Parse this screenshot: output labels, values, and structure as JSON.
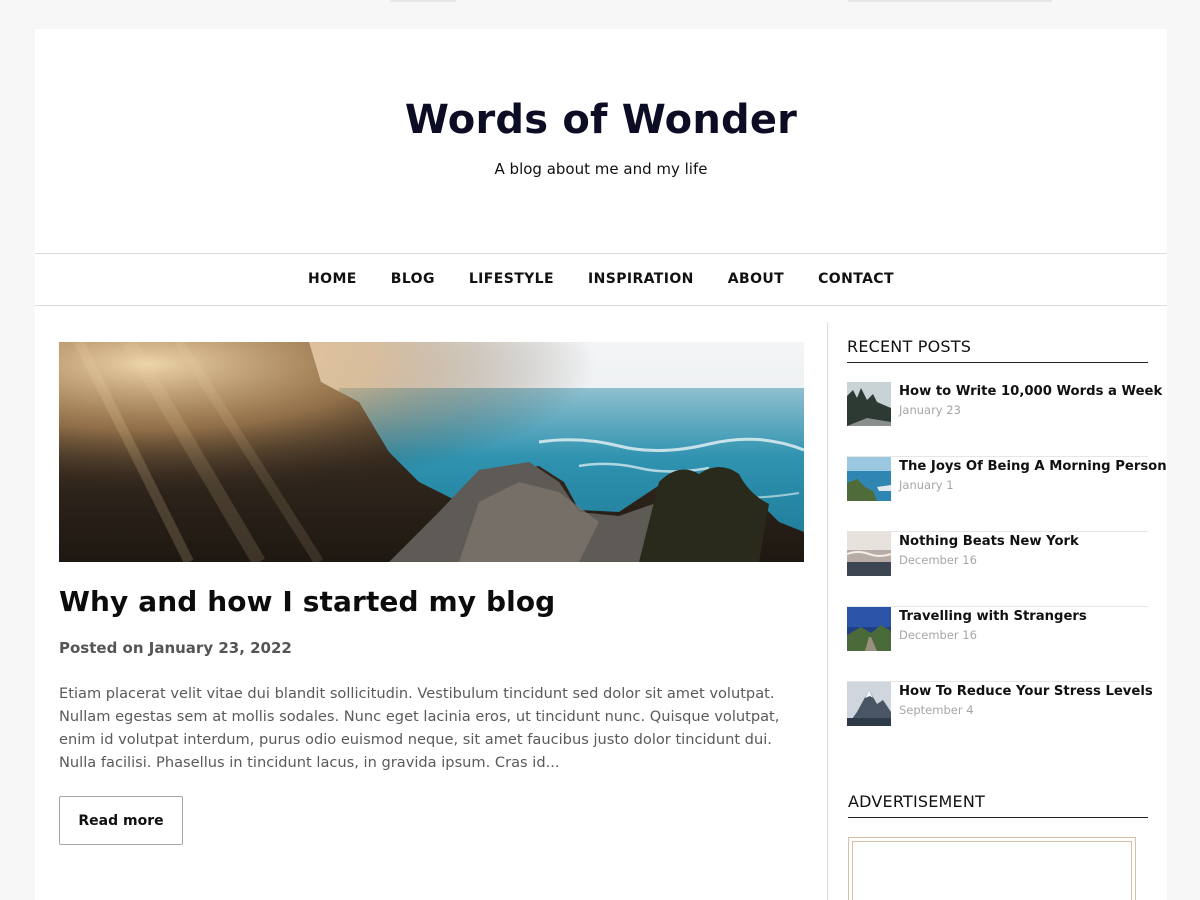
{
  "site": {
    "title": "Words of Wonder",
    "tagline": "A blog about me and my life"
  },
  "nav": {
    "items": [
      {
        "label": "HOME"
      },
      {
        "label": "BLOG"
      },
      {
        "label": "LIFESTYLE"
      },
      {
        "label": "INSPIRATION"
      },
      {
        "label": "ABOUT"
      },
      {
        "label": "CONTACT"
      }
    ]
  },
  "post": {
    "title": "Why and how I started my blog",
    "meta": "Posted on January 23, 2022",
    "excerpt": "Etiam placerat velit vitae dui blandit sollicitudin. Vestibulum tincidunt sed dolor sit amet volutpat. Nullam egestas sem at mollis sodales. Nunc eget lacinia eros, ut tincidunt nunc. Quisque volutpat, enim id volutpat interdum, purus odio euismod neque, sit amet faucibus justo dolor tincidunt dui. Nulla facilisi. Phasellus in tincidunt lacus, in gravida ipsum. Cras id...",
    "read_more_label": "Read more"
  },
  "sidebar": {
    "recent_title": "RECENT POSTS",
    "recent_posts": [
      {
        "title": "How to Write 10,000 Words a Week",
        "date": "January 23"
      },
      {
        "title": "The Joys Of Being A Morning Person",
        "date": "January 1"
      },
      {
        "title": "Nothing Beats New York",
        "date": "December 16"
      },
      {
        "title": "Travelling with Strangers",
        "date": "December 16"
      },
      {
        "title": "How To Reduce Your Stress Levels",
        "date": "September 4"
      }
    ],
    "ad_title": "ADVERTISEMENT"
  },
  "colors": {
    "title": "#0c0c25",
    "muted_date": "#a6a6a6",
    "ad_border": "#d6bfa2"
  }
}
